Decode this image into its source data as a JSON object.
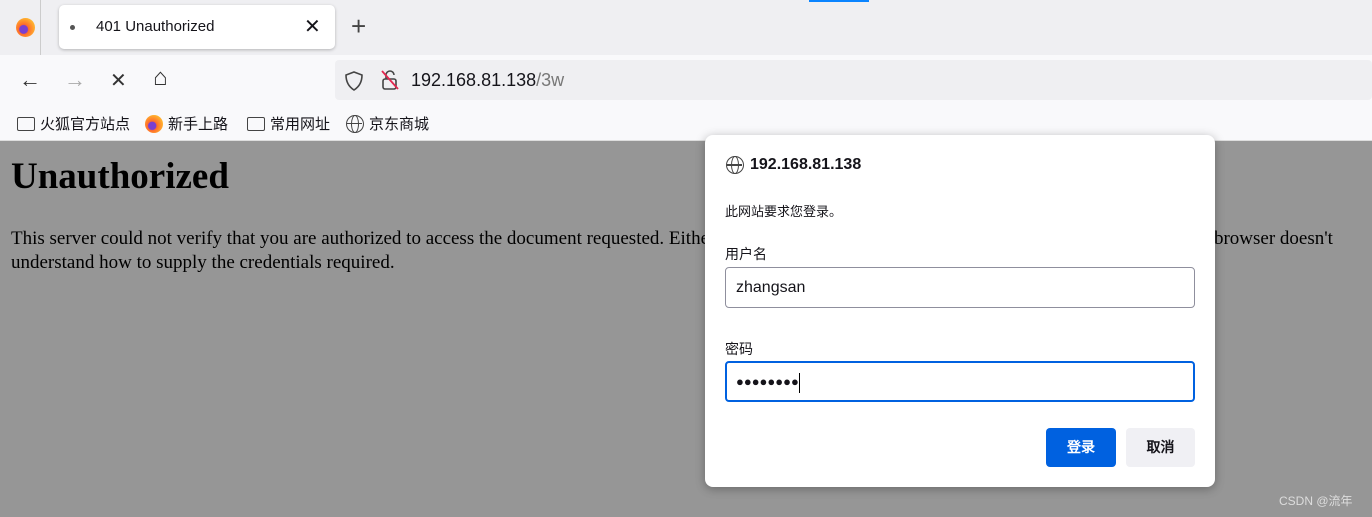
{
  "browser": {
    "tab": {
      "title": "401 Unauthorized",
      "close": "✕"
    },
    "new_tab": "+",
    "nav": {
      "back": "←",
      "forward": "→",
      "stop": "✕",
      "home": "⌂"
    },
    "url": {
      "host": "192.168.81.138",
      "path": "/3w"
    },
    "bookmarks": [
      {
        "label": "火狐官方站点",
        "icon": "folder-icon"
      },
      {
        "label": "新手上路",
        "icon": "firefox-icon"
      },
      {
        "label": "常用网址",
        "icon": "folder-icon"
      },
      {
        "label": "京东商城",
        "icon": "globe-icon"
      }
    ]
  },
  "page": {
    "heading": "Unauthorized",
    "body": "This server could not verify that you are authorized to access the document requested. Either you supplied the wrong credentials (e.g., bad password), or your browser doesn't understand how to supply the credentials required."
  },
  "dialog": {
    "host": "192.168.81.138",
    "message": "此网站要求您登录。",
    "username_label": "用户名",
    "username_value": "zhangsan",
    "password_label": "密码",
    "password_value": "●●●●●●●●",
    "login_label": "登录",
    "cancel_label": "取消",
    "accent": "#0061e0"
  },
  "watermark": "CSDN @流年"
}
